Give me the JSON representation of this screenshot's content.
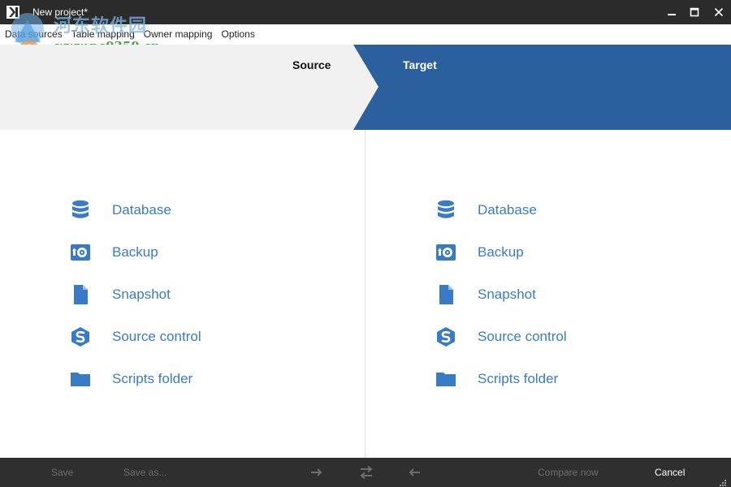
{
  "window": {
    "title": "New project*"
  },
  "menu": {
    "items": [
      "Data sources",
      "Table mapping",
      "Owner mapping",
      "Options"
    ]
  },
  "watermark": {
    "text_cn": "河东软件园",
    "url": "www.pc0359.cn"
  },
  "header": {
    "source_label": "Source",
    "target_label": "Target"
  },
  "source_panel": {
    "options": [
      {
        "label": "Database",
        "icon": "database-icon"
      },
      {
        "label": "Backup",
        "icon": "backup-icon"
      },
      {
        "label": "Snapshot",
        "icon": "snapshot-icon"
      },
      {
        "label": "Source control",
        "icon": "source-control-icon"
      },
      {
        "label": "Scripts folder",
        "icon": "folder-icon"
      }
    ]
  },
  "target_panel": {
    "options": [
      {
        "label": "Database",
        "icon": "database-icon"
      },
      {
        "label": "Backup",
        "icon": "backup-icon"
      },
      {
        "label": "Snapshot",
        "icon": "snapshot-icon"
      },
      {
        "label": "Source control",
        "icon": "source-control-icon"
      },
      {
        "label": "Scripts folder",
        "icon": "folder-icon"
      }
    ]
  },
  "toolbar": {
    "save_label": "Save",
    "save_as_label": "Save as...",
    "compare_now_label": "Compare now",
    "cancel_label": "Cancel"
  },
  "colors": {
    "accent_blue": "#2c5f9e",
    "link_blue": "#3a7bc8",
    "title_bar": "#2b2b2b",
    "bottom_bar": "#2f2f2f",
    "header_gray": "#f1f1f1"
  }
}
